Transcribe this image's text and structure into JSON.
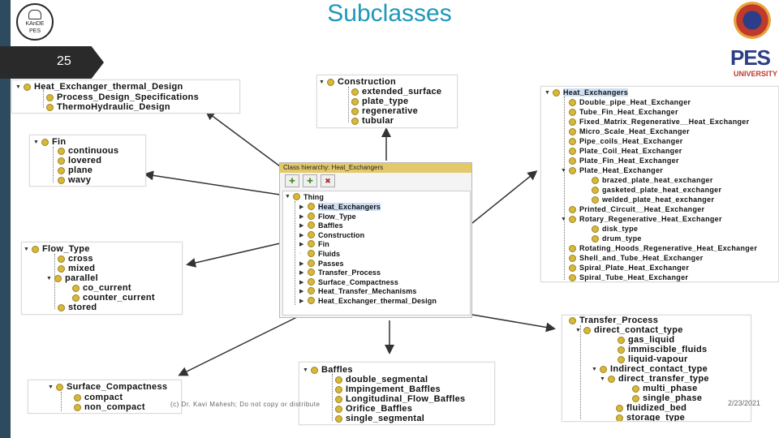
{
  "header": {
    "title": "Subclasses",
    "slide_number": "25"
  },
  "logos": {
    "left_text": "KAnDE\nPES",
    "right_text": "PES",
    "right_sub": "UNIVERSITY"
  },
  "footer": {
    "copyright": "(c) Dr. Kavi Mahesh; Do not copy or distribute",
    "date": "2/23/2021"
  },
  "colors": {
    "title": "#1f97b8",
    "sidebar": "#2d4a5e",
    "node_dot": "#d7b83a",
    "selection": "#cfe0f5"
  },
  "dialog": {
    "title": "Class hierarchy: Heat_Exchangers",
    "root": "Thing",
    "items": [
      "Heat_Exchangers",
      "Flow_Type",
      "Baffles",
      "Construction",
      "Fin",
      "Fluids",
      "Passes",
      "Transfer_Process",
      "Surface_Compactness",
      "Heat_Transfer_Mechanisms",
      "Heat_Exchanger_thermal_Design"
    ]
  },
  "panels": {
    "thermal": {
      "root": "Heat_Exchanger_thermal_Design",
      "children": [
        "Process_Design_Specifications",
        "ThermoHydraulic_Design"
      ]
    },
    "construction": {
      "root": "Construction",
      "children": [
        "extended_surface",
        "plate_type",
        "regenerative",
        "tubular"
      ]
    },
    "heat_exchangers": {
      "root": "Heat_Exchangers",
      "children": [
        "Double_pipe_Heat_Exchanger",
        "Tube_Fin_Heat_Exchanger",
        "Fixed_Matrix_Regenerative__Heat_Exchanger",
        "Micro_Scale_Heat_Exchanger",
        "Pipe_coils_Heat_Exchanger",
        "Plate_Coil_Heat_Exchanger",
        "Plate_Fin_Heat_Exchanger",
        "Plate_Heat_Exchanger",
        "brazed_plate_heat_exchanger",
        "gasketed_plate_heat_exchanger",
        "welded_plate_heat_exchanger",
        "Printed_Circuit__Heat_Exchanger",
        "Rotary_Regenerative_Heat_Exchanger",
        "disk_type",
        "drum_type",
        "Rotating_Hoods_Regenerative_Heat_Exchanger",
        "Shell_and_Tube_Heat_Exchanger",
        "Spiral_Plate_Heat_Exchanger",
        "Spiral_Tube_Heat_Exchanger"
      ]
    },
    "fin": {
      "root": "Fin",
      "children": [
        "continuous",
        "lovered",
        "plane",
        "wavy"
      ]
    },
    "flow_type": {
      "root": "Flow_Type",
      "children": [
        "cross",
        "mixed",
        "parallel",
        "co_current",
        "counter_current",
        "stored"
      ]
    },
    "transfer_process": {
      "root": "Transfer_Process",
      "children": [
        "direct_contact_type",
        "gas_liquid",
        "immiscible_fluids",
        "liquid-vapour",
        "Indirect_contact_type",
        "direct_transfer_type",
        "multi_phase",
        "single_phase",
        "fluidized_bed",
        "storage_type"
      ]
    },
    "surface": {
      "root": "Surface_Compactness",
      "children": [
        "compact",
        "non_compact"
      ]
    },
    "baffles": {
      "root": "Baffles",
      "children": [
        "double_segmental",
        "Impingement_Baffles",
        "Longitudinal_Flow_Baffles",
        "Orifice_Baffles",
        "single_segmental"
      ]
    }
  }
}
